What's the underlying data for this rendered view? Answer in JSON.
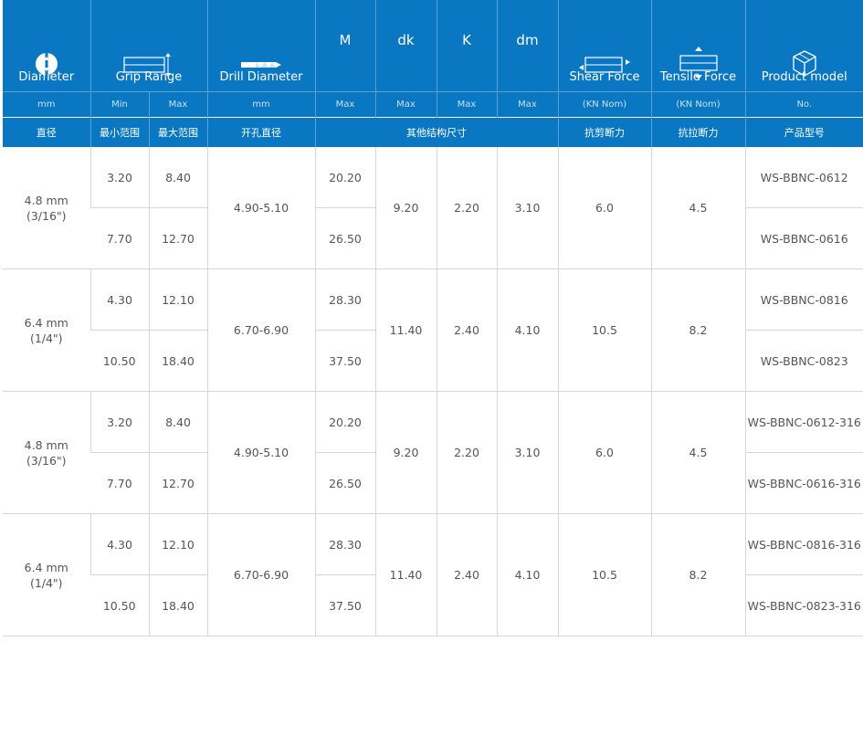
{
  "header": {
    "diameter": {
      "label": "Diameter",
      "unit": "mm",
      "cn": "直径"
    },
    "grip": {
      "label": "Grip Range",
      "min": "Min",
      "max": "Max",
      "cn_min": "最小范围",
      "cn_max": "最大范围"
    },
    "drill": {
      "label": "Drill Diameter",
      "unit": "mm",
      "cn": "开孔直径"
    },
    "m": {
      "label": "M",
      "unit": "Max"
    },
    "dk": {
      "label": "dk",
      "unit": "Max"
    },
    "k": {
      "label": "K",
      "unit": "Max"
    },
    "dm": {
      "label": "dm",
      "unit": "Max"
    },
    "other_cn": "其他结构尺寸",
    "shear": {
      "label": "Shear Force",
      "unit": "(KN Nom)",
      "cn": "抗剪断力"
    },
    "tensile": {
      "label": "Tensile Force",
      "unit": "(KN Nom)",
      "cn": "抗拉断力"
    },
    "model": {
      "label": "Product model",
      "unit": "No.",
      "cn": "产品型号"
    }
  },
  "groups": [
    {
      "dia1": "4.8 mm",
      "dia2": "(3/16\")",
      "drill": "4.90-5.10",
      "dk": "9.20",
      "k": "2.20",
      "dm": "3.10",
      "shear": "6.0",
      "tensile": "4.5",
      "rows": [
        {
          "min": "3.20",
          "max": "8.40",
          "m": "20.20",
          "model": "WS-BBNC-0612"
        },
        {
          "min": "7.70",
          "max": "12.70",
          "m": "26.50",
          "model": "WS-BBNC-0616"
        }
      ]
    },
    {
      "dia1": "6.4 mm",
      "dia2": "(1/4\")",
      "drill": "6.70-6.90",
      "dk": "11.40",
      "k": "2.40",
      "dm": "4.10",
      "shear": "10.5",
      "tensile": "8.2",
      "rows": [
        {
          "min": "4.30",
          "max": "12.10",
          "m": "28.30",
          "model": "WS-BBNC-0816"
        },
        {
          "min": "10.50",
          "max": "18.40",
          "m": "37.50",
          "model": "WS-BBNC-0823"
        }
      ]
    },
    {
      "dia1": "4.8 mm",
      "dia2": "(3/16\")",
      "drill": "4.90-5.10",
      "dk": "9.20",
      "k": "2.20",
      "dm": "3.10",
      "shear": "6.0",
      "tensile": "4.5",
      "rows": [
        {
          "min": "3.20",
          "max": "8.40",
          "m": "20.20",
          "model": "WS-BBNC-0612-316"
        },
        {
          "min": "7.70",
          "max": "12.70",
          "m": "26.50",
          "model": "WS-BBNC-0616-316"
        }
      ]
    },
    {
      "dia1": "6.4 mm",
      "dia2": "(1/4\")",
      "drill": "6.70-6.90",
      "dk": "11.40",
      "k": "2.40",
      "dm": "4.10",
      "shear": "10.5",
      "tensile": "8.2",
      "rows": [
        {
          "min": "4.30",
          "max": "12.10",
          "m": "28.30",
          "model": "WS-BBNC-0816-316"
        },
        {
          "min": "10.50",
          "max": "18.40",
          "m": "37.50",
          "model": "WS-BBNC-0823-316"
        }
      ]
    }
  ],
  "colors": {
    "header_bg": "#0a77c2",
    "border": "#d6d6d6",
    "text": "#555555"
  }
}
